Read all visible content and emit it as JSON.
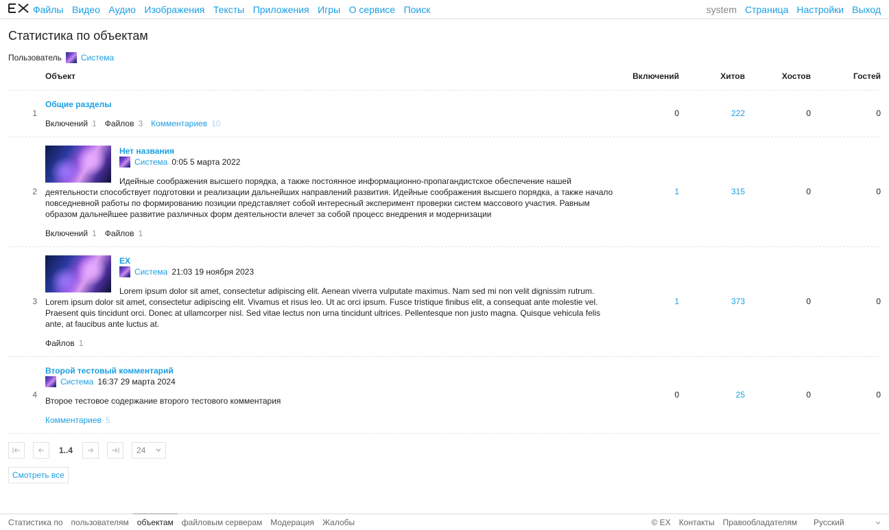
{
  "header": {
    "logo": "EX",
    "nav": [
      "Файлы",
      "Видео",
      "Аудио",
      "Изображения",
      "Тексты",
      "Приложения",
      "Игры",
      "О сервисе",
      "Поиск"
    ],
    "user": "system",
    "links": [
      "Страница",
      "Настройки",
      "Выход"
    ]
  },
  "page_title": "Статистика по объектам",
  "filter": {
    "label": "Пользователь",
    "user": "Система"
  },
  "table": {
    "headers": {
      "object": "Объект",
      "inclusions": "Включений",
      "hits": "Хитов",
      "hosts": "Хостов",
      "guests": "Гостей"
    },
    "rows": [
      {
        "num": "1",
        "title": "Общие разделы",
        "stats": [
          {
            "k": "Включений",
            "v": "1"
          },
          {
            "k": "Файлов",
            "v": "3"
          },
          {
            "k": "Комментариев",
            "v": "10"
          }
        ],
        "inclusions": "0",
        "hits": "222",
        "hosts": "0",
        "guests": "0"
      },
      {
        "num": "2",
        "title": "Нет названия",
        "author": "Система",
        "date": "0:05 5 марта 2022",
        "desc": "Идейные соображения высшего порядка, а также постоянное информационно-пропагандистское обеспечение нашей деятельности способствует подготовки и реализации дальнейших направлений развития. Идейные соображения высшего порядка, а также начало повседневной работы по формированию позиции представляет собой интересный эксперимент проверки систем массового участия. Равным образом дальнейшее развитие различных форм деятельности влечет за собой процесс внедрения и модернизации",
        "stats": [
          {
            "k": "Включений",
            "v": "1"
          },
          {
            "k": "Файлов",
            "v": "1"
          }
        ],
        "inclusions": "1",
        "hits": "315",
        "hosts": "0",
        "guests": "0"
      },
      {
        "num": "3",
        "title": "EX",
        "author": "Система",
        "date": "21:03 19 ноября 2023",
        "desc": "Lorem ipsum dolor sit amet, consectetur adipiscing elit. Aenean viverra vulputate maximus. Nam sed mi non velit dignissim rutrum. Lorem ipsum dolor sit amet, consectetur adipiscing elit. Vivamus et risus leo. Ut ac orci ipsum. Fusce tristique finibus elit, a consequat ante molestie vel. Praesent quis tincidunt orci. Donec at ullamcorper nisl. Sed vitae lectus non urna tincidunt ultrices. Pellentesque non justo magna. Quisque vehicula felis ante, at faucibus ante luctus at.",
        "stats": [
          {
            "k": "Файлов",
            "v": "1"
          }
        ],
        "inclusions": "1",
        "hits": "373",
        "hosts": "0",
        "guests": "0"
      },
      {
        "num": "4",
        "title": "Второй тестовый комментарий",
        "author": "Система",
        "date": "16:37 29 марта 2024",
        "desc": "Второе тестовое содержание второго тестового комментария",
        "stats": [
          {
            "k": "Комментариев",
            "v": "5"
          }
        ],
        "inclusions": "0",
        "hits": "25",
        "hosts": "0",
        "guests": "0"
      }
    ]
  },
  "pager": {
    "info": "1..4",
    "per_page": "24"
  },
  "show_all": "Смотреть все",
  "footer": {
    "tabs": [
      "Статистика по",
      "пользователям",
      "объектам",
      "файловым серверам",
      "Модерация",
      "Жалобы"
    ],
    "right": [
      "© EX",
      "Контакты",
      "Правообладателям"
    ],
    "language": "Русский"
  }
}
